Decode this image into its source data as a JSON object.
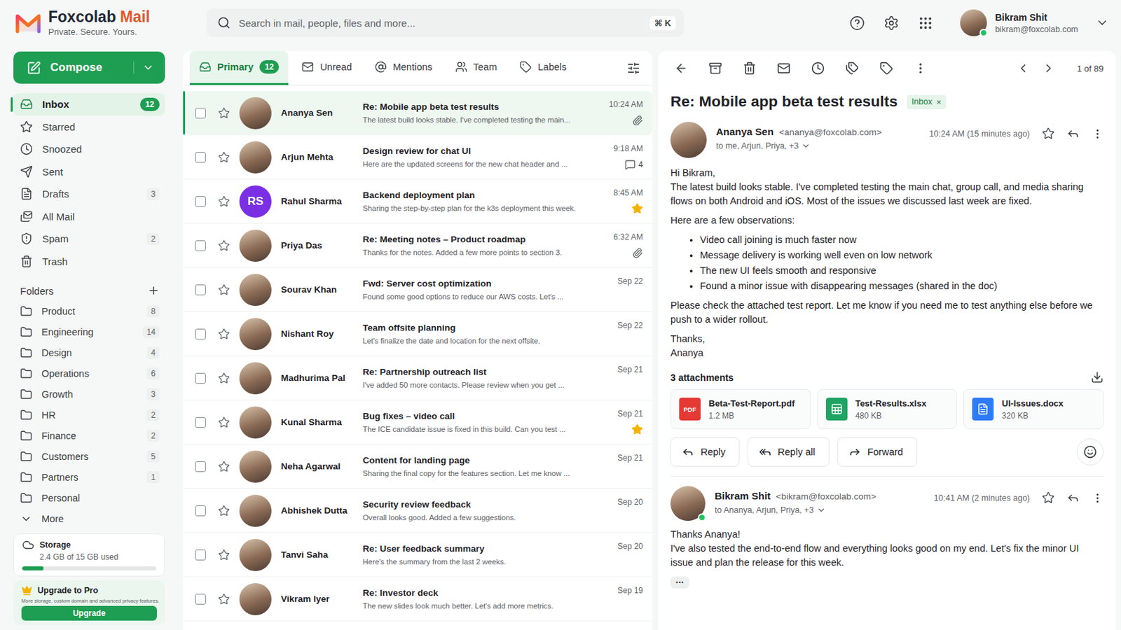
{
  "header": {
    "brand": {
      "name": "Foxcolab",
      "product": "Mail",
      "tagline": "Private. Secure. Yours."
    },
    "search": {
      "placeholder": "Search in mail, people, files and more...",
      "shortcut": "⌘ K"
    },
    "user": {
      "name": "Bikram Shit",
      "email": "bikram@foxcolab.com",
      "online": true
    }
  },
  "sidebar": {
    "compose": "Compose",
    "items": [
      {
        "label": "Inbox",
        "count": "12",
        "selected": true
      },
      {
        "label": "Starred",
        "selected": false
      },
      {
        "label": "Snoozed",
        "selected": false
      },
      {
        "label": "Sent",
        "selected": false
      },
      {
        "label": "Drafts",
        "count": "3",
        "selected": false
      },
      {
        "label": "All Mail",
        "selected": false
      },
      {
        "label": "Spam",
        "count": "2",
        "selected": false
      },
      {
        "label": "Trash",
        "selected": false
      }
    ],
    "folders_title": "Folders",
    "folders": [
      {
        "label": "Product",
        "count": "8",
        "selected": false
      },
      {
        "label": "Engineering",
        "count": "14",
        "selected": false
      },
      {
        "label": "Design",
        "count": "4",
        "selected": false
      },
      {
        "label": "Operations",
        "count": "6",
        "selected": false
      },
      {
        "label": "Growth",
        "count": "3",
        "selected": false
      },
      {
        "label": "HR",
        "count": "2",
        "selected": false
      },
      {
        "label": "Finance",
        "count": "2",
        "selected": false
      },
      {
        "label": "Customers",
        "count": "5",
        "selected": false
      },
      {
        "label": "Partners",
        "count": "1",
        "selected": false
      },
      {
        "label": "Personal",
        "selected": false
      }
    ],
    "more": "More",
    "storage": {
      "title": "Storage",
      "text": "2.4 GB of 15 GB used",
      "level": 0.16
    },
    "upgrade": {
      "title": "Upgrade to Pro",
      "text": "More storage, custom domain and advanced privacy features.",
      "button": "Upgrade"
    }
  },
  "mail_list": {
    "tabs": [
      {
        "label": "Primary",
        "count": "12",
        "selected": true
      },
      {
        "label": "Unread",
        "selected": false
      },
      {
        "label": "Mentions",
        "selected": false
      },
      {
        "label": "Team",
        "selected": false
      },
      {
        "label": "Labels",
        "selected": false
      }
    ],
    "rows": [
      {
        "sender": "Ananya Sen",
        "subject": "Re: Mobile app beta test results",
        "preview": "The latest build looks stable. I've completed testing the main...",
        "time": "10:24 AM",
        "attachment": true,
        "priority": false,
        "checked": false,
        "starred": false,
        "selected": true,
        "avatar": {
          "kind": "photo"
        }
      },
      {
        "sender": "Arjun Mehta",
        "subject": "Design review for chat UI",
        "preview": "Here are the updated screens for the new chat header and ...",
        "time": "9:18 AM",
        "comments": "4",
        "attachment": false,
        "priority": false,
        "checked": false,
        "starred": false,
        "selected": false,
        "avatar": {
          "kind": "photo"
        }
      },
      {
        "sender": "Rahul Sharma",
        "subject": "Backend deployment plan",
        "preview": "Sharing the step-by-step plan for the k3s deployment this week.",
        "time": "8:45 AM",
        "attachment": false,
        "priority": true,
        "checked": false,
        "starred": false,
        "selected": false,
        "avatar": {
          "kind": "initials",
          "text": "RS",
          "color": "#7b2fe3"
        }
      },
      {
        "sender": "Priya Das",
        "subject": "Re: Meeting notes – Product roadmap",
        "preview": "Thanks for the notes. Added a few more points to section 3.",
        "time": "6:32 AM",
        "attachment": true,
        "priority": false,
        "checked": false,
        "starred": false,
        "selected": false,
        "avatar": {
          "kind": "photo"
        }
      },
      {
        "sender": "Sourav Khan",
        "subject": "Fwd: Server cost optimization",
        "preview": "Found some good options to reduce our AWS costs. Let's ...",
        "time": "Sep 22",
        "attachment": false,
        "priority": false,
        "checked": false,
        "starred": false,
        "selected": false,
        "avatar": {
          "kind": "photo"
        }
      },
      {
        "sender": "Nishant Roy",
        "subject": "Team offsite planning",
        "preview": "Let's finalize the date and location for the next offsite.",
        "time": "Sep 22",
        "attachment": false,
        "priority": false,
        "checked": false,
        "starred": false,
        "selected": false,
        "avatar": {
          "kind": "photo"
        }
      },
      {
        "sender": "Madhurima Pal",
        "subject": "Re: Partnership outreach list",
        "preview": "I've added 50 more contacts. Please review when you get ...",
        "time": "Sep 21",
        "attachment": false,
        "priority": false,
        "checked": false,
        "starred": false,
        "selected": false,
        "avatar": {
          "kind": "photo"
        }
      },
      {
        "sender": "Kunal Sharma",
        "subject": "Bug fixes – video call",
        "preview": "The ICE candidate issue is fixed in this build. Can you test ...",
        "time": "Sep 21",
        "attachment": false,
        "priority": true,
        "checked": false,
        "starred": false,
        "selected": false,
        "avatar": {
          "kind": "photo"
        }
      },
      {
        "sender": "Neha Agarwal",
        "subject": "Content for landing page",
        "preview": "Sharing the final copy for the features section. Let me know ...",
        "time": "Sep 21",
        "attachment": false,
        "priority": false,
        "checked": false,
        "starred": false,
        "selected": false,
        "avatar": {
          "kind": "photo"
        }
      },
      {
        "sender": "Abhishek Dutta",
        "subject": "Security review feedback",
        "preview": "Overall looks good. Added a few suggestions.",
        "time": "Sep 20",
        "attachment": false,
        "priority": false,
        "checked": false,
        "starred": false,
        "selected": false,
        "avatar": {
          "kind": "photo"
        }
      },
      {
        "sender": "Tanvi Saha",
        "subject": "Re: User feedback summary",
        "preview": "Here's the summary from the last 2 weeks.",
        "time": "Sep 20",
        "attachment": false,
        "priority": false,
        "checked": false,
        "starred": false,
        "selected": false,
        "avatar": {
          "kind": "photo"
        }
      },
      {
        "sender": "Vikram Iyer",
        "subject": "Re: Investor deck",
        "preview": "The new slides look much better. Let's add more metrics.",
        "time": "Sep 19",
        "attachment": false,
        "priority": false,
        "checked": false,
        "starred": false,
        "selected": false,
        "avatar": {
          "kind": "photo"
        }
      }
    ]
  },
  "reading_pane": {
    "pager": "1 of 89",
    "subject": "Re: Mobile app beta test results",
    "label": {
      "text": "Inbox",
      "close": "×"
    },
    "messages": [
      {
        "sender": "Ananya Sen",
        "email": "<ananya@foxcolab.com>",
        "time": "10:24 AM (15 minutes ago)",
        "to": "to me, Arjun, Priya, +3",
        "starred": false,
        "online": false,
        "blocks": [
          {
            "kind": "para",
            "lines": [
              "Hi Bikram,",
              "The latest build looks stable. I've completed testing the main chat, group call, and media sharing flows on both Android and iOS. Most of the issues we discussed last week are fixed."
            ]
          },
          {
            "kind": "para",
            "lines": [
              "Here are a few observations:"
            ]
          },
          {
            "kind": "list",
            "items": [
              "Video call joining is much faster now",
              "Message delivery is working well even on low network",
              "The new UI feels smooth and responsive",
              "Found a minor issue with disappearing messages (shared in the doc)"
            ]
          },
          {
            "kind": "para",
            "lines": [
              "Please check the attached test report. Let me know if you need me to test anything else before we push to a wider rollout."
            ]
          },
          {
            "kind": "para",
            "lines": [
              "Thanks,",
              "Ananya"
            ]
          }
        ],
        "attachments": {
          "title": "3 attachments",
          "files": [
            {
              "kind": "pdf",
              "badge": "PDF",
              "name": "Beta-Test-Report.pdf",
              "size": "1.2 MB"
            },
            {
              "kind": "sheet",
              "name": "Test-Results.xlsx",
              "size": "480 KB"
            },
            {
              "kind": "doc",
              "name": "UI-Issues.docx",
              "size": "320 KB"
            }
          ]
        },
        "actions": [
          "Reply",
          "Reply all",
          "Forward"
        ]
      },
      {
        "sender": "Bikram Shit",
        "email": "<bikram@foxcolab.com>",
        "time": "10:41 AM (2 minutes ago)",
        "to": "to Ananya, Arjun, Priya, +3",
        "starred": false,
        "online": true,
        "blocks": [
          {
            "kind": "para",
            "lines": [
              "Thanks Ananya!",
              "I've also tested the end-to-end flow and everything looks good on my end. Let's fix the minor UI issue and plan the release for this week."
            ]
          }
        ],
        "more": "•••"
      }
    ]
  }
}
